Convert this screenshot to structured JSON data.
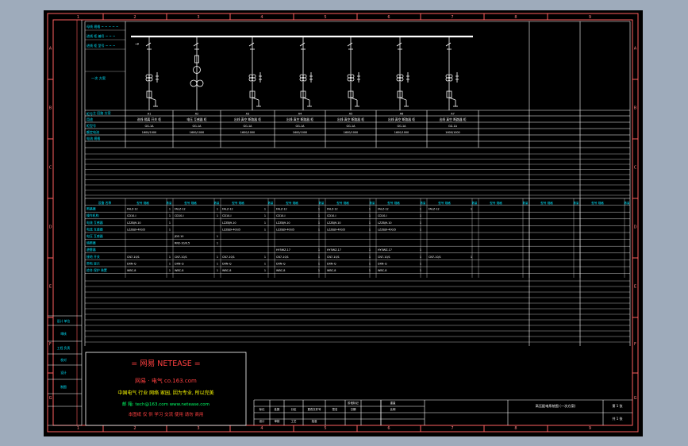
{
  "colors": {
    "background": "#9eabbb",
    "canvas": "#000000",
    "frame": "#ff6060",
    "lines": "#ffffff",
    "labels": "#00e5ff",
    "ad_title": "#ff4040",
    "ad_slogan": "#ffff00",
    "ad_site": "#00ff66",
    "ad_warn": "#ff4040"
  },
  "grid": {
    "top_numbers": [
      "1",
      "2",
      "3",
      "4",
      "5",
      "6",
      "7",
      "8",
      "9"
    ],
    "bottom_numbers": [
      "1",
      "2",
      "3",
      "4",
      "5",
      "6",
      "7",
      "8",
      "9"
    ],
    "side_letters": [
      "A",
      "B",
      "C",
      "D",
      "E",
      "F",
      "G"
    ]
  },
  "left_labels": {
    "r1": "母线 规格 ~ ~ ~ ~ ~",
    "r2": "进线 柜 编号 ~ ~ ~",
    "r3": "进线 柜 型号 ~ ~ ~",
    "r4": "一次 方案",
    "r5": "主 回路 方案"
  },
  "upper_rows": [
    "柜号",
    "用途",
    "柜型号",
    "额定电流",
    "电流 规格"
  ],
  "cabinets": [
    {
      "id": "A1",
      "use": "进线 隔离 开关 柜",
      "type": "GG-1A",
      "rating": "1600/1000"
    },
    {
      "id": "A2",
      "use": "电压 互感器 柜",
      "type": "GG-1A",
      "rating": "1600/1000"
    },
    {
      "id": "A3",
      "use": "出线 真空 断路器 柜",
      "type": "GG-1A",
      "rating": "1600/1000"
    },
    {
      "id": "A4",
      "use": "出线 真空 断路器 柜",
      "type": "GG-1A",
      "rating": "1600/1000"
    },
    {
      "id": "A5",
      "use": "出线 真空 断路器 柜",
      "type": "GG-1A",
      "rating": "1600/1000"
    },
    {
      "id": "A6",
      "use": "出线 真空 断路器 柜",
      "type": "GG-1A",
      "rating": "1600/1000"
    },
    {
      "id": "A7",
      "use": "出线 真空 断路器 柜",
      "type": "GG-1A",
      "rating": "1600/1000"
    }
  ],
  "lower_header": {
    "name": "设备 名称",
    "model": "型号 规格",
    "qty": "数量"
  },
  "lower_rows": [
    {
      "name": "断路器",
      "vals": [
        "FALZ-12",
        "FALZ-12",
        "FALZ-12",
        "FALZ-12",
        "FALZ-12",
        "FALZ-12",
        "FALZ-12"
      ]
    },
    {
      "name": "操作机构",
      "vals": [
        "CD10-I",
        "CD10-I",
        "CD10-I",
        "CD10-I",
        "CD10-I",
        "CD10-I",
        ""
      ]
    },
    {
      "name": "电流 互感器",
      "vals": [
        "LZZBJ9-10",
        "",
        "LZZBJ9-10",
        "LZZBJ9-10",
        "LZZBJ9-10",
        "LZZBJ9-10",
        ""
      ]
    },
    {
      "name": "电流 互感器",
      "vals": [
        "LZZBJ9-400/5",
        "",
        "LZZBJ9-400/5",
        "LZZBJ9-400/5",
        "LZZBJ9-400/5",
        "LZZBJ9-400/5",
        ""
      ]
    },
    {
      "name": "电压 互感器",
      "vals": [
        "",
        "JDZ-10",
        "",
        "",
        "",
        "",
        ""
      ]
    },
    {
      "name": "熔断器",
      "vals": [
        "",
        "RN2-10/0.5",
        "",
        "",
        "",
        "",
        ""
      ]
    },
    {
      "name": "避雷器",
      "vals": [
        "",
        "",
        "",
        "HY5WZ-17",
        "HY5WZ-17",
        "HY5WZ-17",
        ""
      ]
    },
    {
      "name": "接地 开关",
      "vals": [
        "CN7-10/1",
        "CN7-10/1",
        "CN7-10/1",
        "CN7-10/1",
        "CN7-10/1",
        "CN7-10/1",
        "CN7-10/1"
      ]
    },
    {
      "name": "带电 显示",
      "vals": [
        "DXN-Q",
        "DXN-Q",
        "DXN-Q",
        "DXN-Q",
        "DXN-Q",
        "DXN-Q",
        ""
      ]
    },
    {
      "name": "综合 保护 装置",
      "vals": [
        "WBC-8",
        "WBC-8",
        "WBC-8",
        "WBC-8",
        "WBC-8",
        "WBC-8",
        ""
      ]
    }
  ],
  "side_stack": [
    "设计 单位",
    "审核",
    "工程 负责",
    "校对",
    "设计",
    "制图"
  ],
  "title_block": {
    "drawing_title": "高压配电系统图 (一次方案)",
    "sheet_no": "第 1 张",
    "total": "共 1 张",
    "cells": [
      "标记",
      "处数",
      "分区",
      "更改文件号",
      "签名",
      "日期",
      "设计",
      "审核",
      "工艺",
      "批准",
      "阶段标记",
      "重量",
      "比例"
    ]
  },
  "ad": {
    "title": "= 网易 NETEASE =",
    "line2": "网易 · 电气   co.163.com",
    "slogan": "中国电气 行业 网络 家园, 因为专业, 所以完美",
    "email": "邮 箱: tech@163.com  www.netease.com",
    "warn": "本图纸 仅 供 学习 交流 使用 请勿 商用"
  }
}
